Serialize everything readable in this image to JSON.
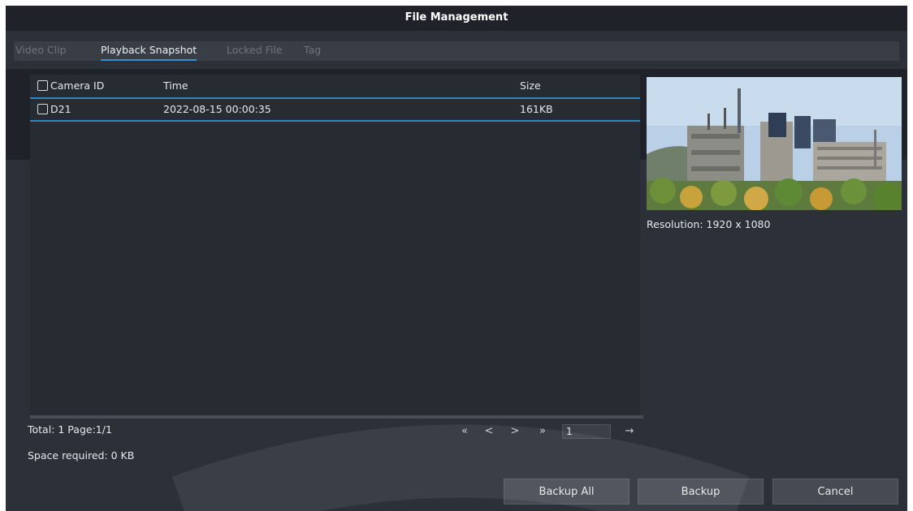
{
  "window": {
    "title": "File Management"
  },
  "tabs": [
    {
      "label": "Video Clip"
    },
    {
      "label": "Playback Snapshot",
      "active": true
    },
    {
      "label": "Locked File"
    },
    {
      "label": "Tag"
    }
  ],
  "table": {
    "columns": [
      "Camera ID",
      "Time",
      "Size"
    ],
    "rows": [
      {
        "camera_id": "D21",
        "time": "2022-08-15 00:00:35",
        "size": "161KB"
      }
    ]
  },
  "preview": {
    "resolution_label": "Resolution: 1920 x 1080"
  },
  "footer": {
    "total": "Total: 1  Page:1/1",
    "space_required": "Space required: 0 KB"
  },
  "pager": {
    "first": "«",
    "prev": "<",
    "next": ">",
    "last": "»",
    "page_value": "1",
    "go": "→"
  },
  "buttons": {
    "backup_all": "Backup All",
    "backup": "Backup",
    "cancel": "Cancel"
  },
  "colors": {
    "background": "#2c3038",
    "title_bar": "#1f2228",
    "accent": "#2f86c8"
  }
}
